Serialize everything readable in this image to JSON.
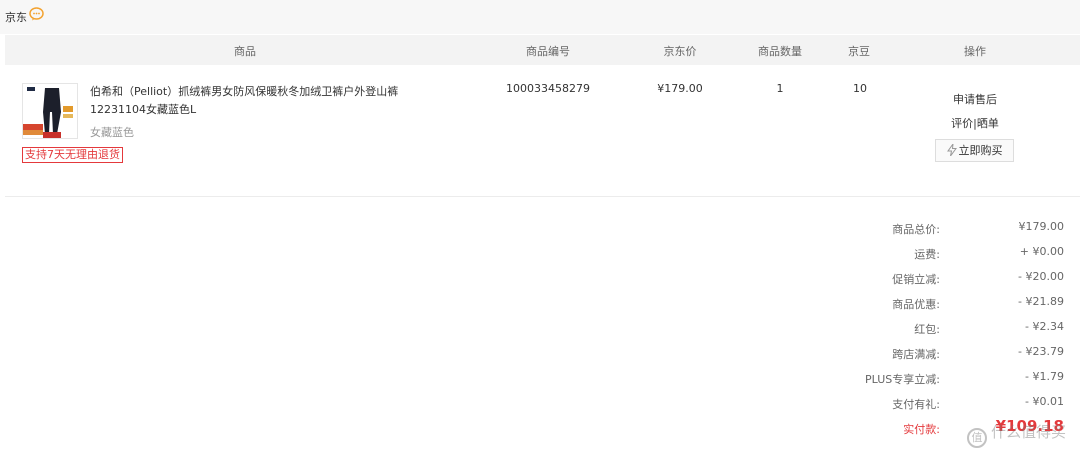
{
  "shop": {
    "name": "京东"
  },
  "table": {
    "headers": {
      "product": "商品",
      "code": "商品编号",
      "price": "京东价",
      "qty": "商品数量",
      "beans": "京豆",
      "ops": "操作"
    }
  },
  "item": {
    "title": "伯希和（Pelliot）抓绒裤男女防风保暖秋冬加绒卫裤户外登山裤12231104女藏蓝色L",
    "variant": "女藏蓝色",
    "badge": "支持7天无理由退货",
    "code": "100033458279",
    "price": "¥179.00",
    "qty": "1",
    "beans": "10"
  },
  "actions": {
    "after_sale": "申请售后",
    "review": "评价",
    "separator": "|",
    "share": "晒单",
    "buy_again": "立即购买"
  },
  "summary": {
    "rows": [
      {
        "label": "商品总价:",
        "value": "¥179.00"
      },
      {
        "label": "运费:",
        "value": "+ ¥0.00"
      },
      {
        "label": "促销立减:",
        "value": "- ¥20.00"
      },
      {
        "label": "商品优惠:",
        "value": "- ¥21.89"
      },
      {
        "label": "红包:",
        "value": "- ¥2.34"
      },
      {
        "label": "跨店满减:",
        "value": "- ¥23.79"
      },
      {
        "label": "PLUS专享立减:",
        "value": "- ¥1.79"
      },
      {
        "label": "支付有礼:",
        "value": "- ¥0.01"
      }
    ],
    "pay_label": "实付款:",
    "pay_value": "¥109.18"
  },
  "watermark": {
    "text": "什么值得买",
    "icon_text": "值"
  },
  "colors": {
    "accent_red": "#e4393c",
    "header_bg": "#f3f3f3",
    "top_bg": "#f7f7f7"
  }
}
